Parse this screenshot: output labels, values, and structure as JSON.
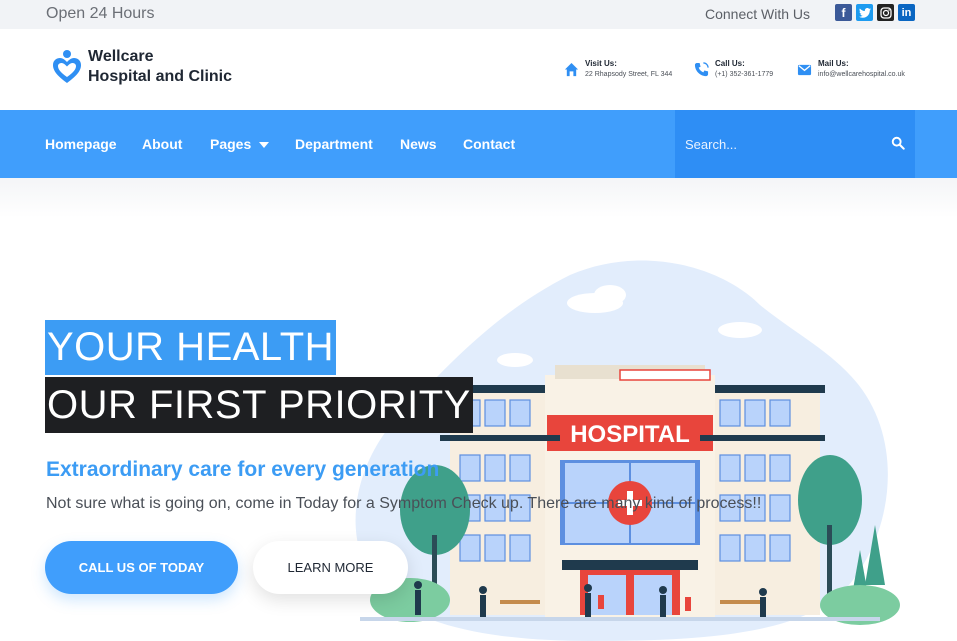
{
  "topbar": {
    "hours": "Open 24 Hours",
    "connect": "Connect With Us",
    "social": [
      "facebook-icon",
      "twitter-icon",
      "instagram-icon",
      "linkedin-icon"
    ]
  },
  "header": {
    "brand_line1": "Wellcare",
    "brand_line2": "Hospital and Clinic",
    "contacts": [
      {
        "icon": "home-icon",
        "title": "Visit Us:",
        "value": "22 Rhapsody Street, FL 344"
      },
      {
        "icon": "phone-icon",
        "title": "Call Us:",
        "value": "(+1) 352-361-1779"
      },
      {
        "icon": "mail-icon",
        "title": "Mail Us:",
        "value": "info@wellcarehospital.co.uk"
      }
    ]
  },
  "nav": {
    "items": [
      "Homepage",
      "About",
      "Pages",
      "Department",
      "News",
      "Contact"
    ],
    "search_placeholder": "Search..."
  },
  "hero": {
    "title_line1": "YOUR HEALTH",
    "title_line2": "OUR FIRST PRIORITY",
    "subtitle": "Extraordinary care for every generation",
    "description": "Not sure what is going on, come in Today for a Symptom Check up. There are many kind of process!!",
    "cta_primary": "CALL US OF TODAY",
    "cta_secondary": "LEARN MORE",
    "illustration_sign": "HOSPITAL"
  },
  "colors": {
    "accent": "#409efc",
    "nav_bg": "#409efc",
    "search_bg": "#2e8ef5",
    "dark_highlight": "#1e1f22",
    "sign_red": "#e8453c"
  }
}
